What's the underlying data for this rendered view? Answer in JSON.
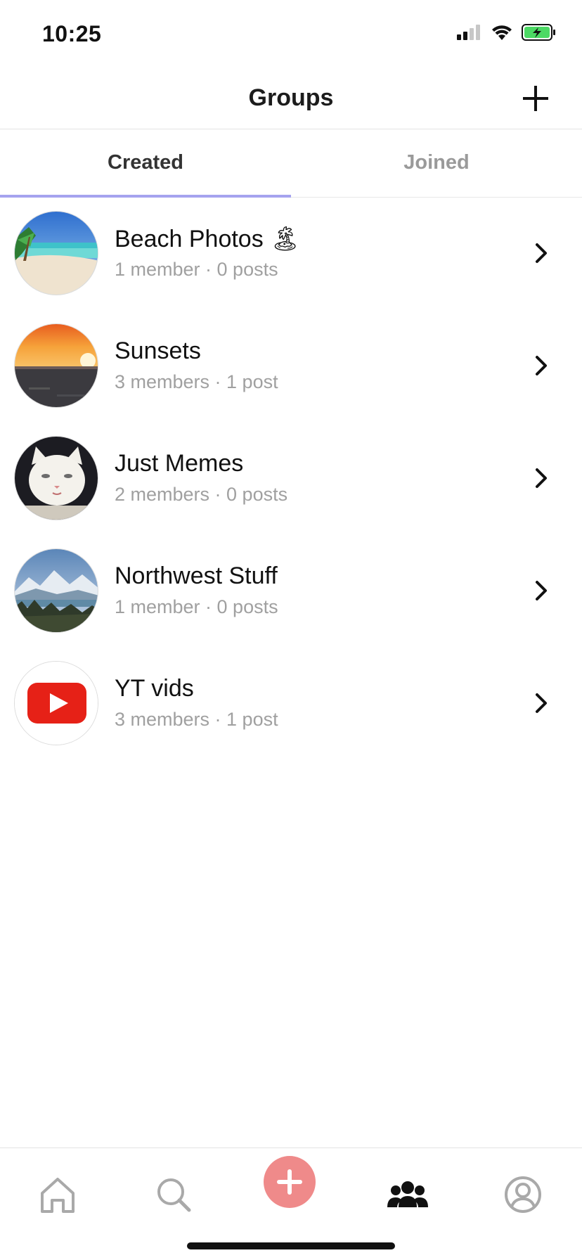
{
  "status_bar": {
    "time": "10:25",
    "icons": [
      "signal-icon",
      "wifi-icon",
      "battery-charging-icon"
    ],
    "battery_color": "#4cd964"
  },
  "header": {
    "title": "Groups",
    "add_icon": "plus-icon"
  },
  "tabs": [
    {
      "label": "Created",
      "active": true
    },
    {
      "label": "Joined",
      "active": false
    }
  ],
  "accent_color": "#a5a3ef",
  "groups": [
    {
      "name": "Beach Photos 🏝",
      "meta": "1 member · 0 posts",
      "avatar": "beach-photo"
    },
    {
      "name": "Sunsets",
      "meta": "3 members · 1 post",
      "avatar": "sunset-photo"
    },
    {
      "name": "Just Memes",
      "meta": "2 members · 0 posts",
      "avatar": "cat-photo"
    },
    {
      "name": "Northwest Stuff",
      "meta": "1 member · 0 posts",
      "avatar": "mountain-photo"
    },
    {
      "name": "YT vids",
      "meta": "3 members · 1 post",
      "avatar": "youtube-logo"
    }
  ],
  "bottom_nav": {
    "items": [
      "home-icon",
      "search-icon",
      "create-post-icon",
      "groups-icon",
      "profile-icon"
    ],
    "active": "groups-icon",
    "create_color": "#ef8a8a"
  }
}
